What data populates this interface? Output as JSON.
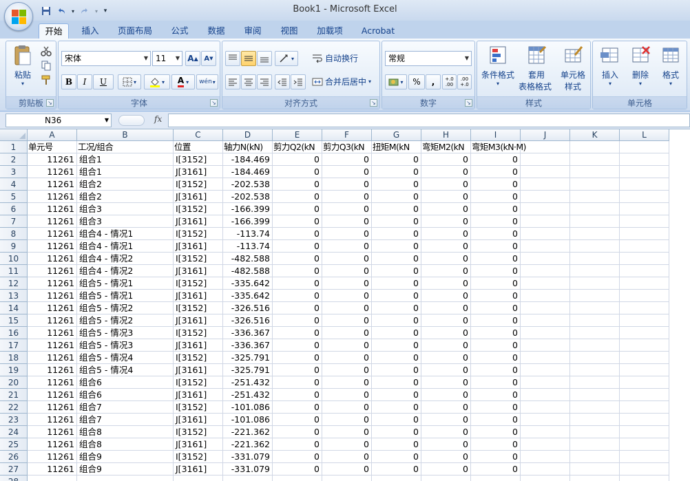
{
  "window": {
    "title": "Book1 - Microsoft Excel"
  },
  "tabs": [
    "开始",
    "插入",
    "页面布局",
    "公式",
    "数据",
    "审阅",
    "视图",
    "加载项",
    "Acrobat"
  ],
  "active_tab": "开始",
  "ribbon": {
    "clipboard": {
      "label": "剪贴板",
      "paste": "粘贴"
    },
    "font": {
      "label": "字体",
      "name": "宋体",
      "size": "11",
      "bold": "B",
      "italic": "I",
      "underline": "U",
      "font_color_glyph": "A",
      "phonetic_glyph": "wén"
    },
    "alignment": {
      "label": "对齐方式",
      "wrap_text": "自动换行",
      "merge_center": "合并后居中"
    },
    "number": {
      "label": "数字",
      "format": "常规",
      "percent": "%",
      "comma": ",",
      "increase_decimal": "+.0\n.00",
      "decrease_decimal": ".00\n+.0"
    },
    "styles": {
      "label": "样式",
      "conditional": "条件格式",
      "table_format_1": "套用",
      "table_format_2": "表格格式",
      "cell_styles_1": "单元格",
      "cell_styles_2": "样式"
    },
    "cells": {
      "label": "单元格",
      "insert": "插入",
      "delete": "删除",
      "format": "格式"
    }
  },
  "formula_bar": {
    "name_box": "N36",
    "fx": "fx",
    "formula": ""
  },
  "sheet": {
    "columns": [
      "A",
      "B",
      "C",
      "D",
      "E",
      "F",
      "G",
      "H",
      "I",
      "J",
      "K",
      "L"
    ],
    "header_row": [
      "单元号",
      "工况/组合",
      "位置",
      "轴力N(kN)",
      "剪力Q2(kN",
      "剪力Q3(kN",
      "扭矩M(kN",
      "弯矩M2(kN",
      "弯矩M3(kN·M)"
    ],
    "rows": [
      [
        "11261",
        "组合1",
        "I[3152]",
        "-184.469",
        "0",
        "0",
        "0",
        "0",
        "0"
      ],
      [
        "11261",
        "组合1",
        "J[3161]",
        "-184.469",
        "0",
        "0",
        "0",
        "0",
        "0"
      ],
      [
        "11261",
        "组合2",
        "I[3152]",
        "-202.538",
        "0",
        "0",
        "0",
        "0",
        "0"
      ],
      [
        "11261",
        "组合2",
        "J[3161]",
        "-202.538",
        "0",
        "0",
        "0",
        "0",
        "0"
      ],
      [
        "11261",
        "组合3",
        "I[3152]",
        "-166.399",
        "0",
        "0",
        "0",
        "0",
        "0"
      ],
      [
        "11261",
        "组合3",
        "J[3161]",
        "-166.399",
        "0",
        "0",
        "0",
        "0",
        "0"
      ],
      [
        "11261",
        "组合4 - 情况1",
        "I[3152]",
        "-113.74",
        "0",
        "0",
        "0",
        "0",
        "0"
      ],
      [
        "11261",
        "组合4 - 情况1",
        "J[3161]",
        "-113.74",
        "0",
        "0",
        "0",
        "0",
        "0"
      ],
      [
        "11261",
        "组合4 - 情况2",
        "I[3152]",
        "-482.588",
        "0",
        "0",
        "0",
        "0",
        "0"
      ],
      [
        "11261",
        "组合4 - 情况2",
        "J[3161]",
        "-482.588",
        "0",
        "0",
        "0",
        "0",
        "0"
      ],
      [
        "11261",
        "组合5 - 情况1",
        "I[3152]",
        "-335.642",
        "0",
        "0",
        "0",
        "0",
        "0"
      ],
      [
        "11261",
        "组合5 - 情况1",
        "J[3161]",
        "-335.642",
        "0",
        "0",
        "0",
        "0",
        "0"
      ],
      [
        "11261",
        "组合5 - 情况2",
        "I[3152]",
        "-326.516",
        "0",
        "0",
        "0",
        "0",
        "0"
      ],
      [
        "11261",
        "组合5 - 情况2",
        "J[3161]",
        "-326.516",
        "0",
        "0",
        "0",
        "0",
        "0"
      ],
      [
        "11261",
        "组合5 - 情况3",
        "I[3152]",
        "-336.367",
        "0",
        "0",
        "0",
        "0",
        "0"
      ],
      [
        "11261",
        "组合5 - 情况3",
        "J[3161]",
        "-336.367",
        "0",
        "0",
        "0",
        "0",
        "0"
      ],
      [
        "11261",
        "组合5 - 情况4",
        "I[3152]",
        "-325.791",
        "0",
        "0",
        "0",
        "0",
        "0"
      ],
      [
        "11261",
        "组合5 - 情况4",
        "J[3161]",
        "-325.791",
        "0",
        "0",
        "0",
        "0",
        "0"
      ],
      [
        "11261",
        "组合6",
        "I[3152]",
        "-251.432",
        "0",
        "0",
        "0",
        "0",
        "0"
      ],
      [
        "11261",
        "组合6",
        "J[3161]",
        "-251.432",
        "0",
        "0",
        "0",
        "0",
        "0"
      ],
      [
        "11261",
        "组合7",
        "I[3152]",
        "-101.086",
        "0",
        "0",
        "0",
        "0",
        "0"
      ],
      [
        "11261",
        "组合7",
        "J[3161]",
        "-101.086",
        "0",
        "0",
        "0",
        "0",
        "0"
      ],
      [
        "11261",
        "组合8",
        "I[3152]",
        "-221.362",
        "0",
        "0",
        "0",
        "0",
        "0"
      ],
      [
        "11261",
        "组合8",
        "J[3161]",
        "-221.362",
        "0",
        "0",
        "0",
        "0",
        "0"
      ],
      [
        "11261",
        "组合9",
        "I[3152]",
        "-331.079",
        "0",
        "0",
        "0",
        "0",
        "0"
      ],
      [
        "11261",
        "组合9",
        "J[3161]",
        "-331.079",
        "0",
        "0",
        "0",
        "0",
        "0"
      ]
    ]
  }
}
